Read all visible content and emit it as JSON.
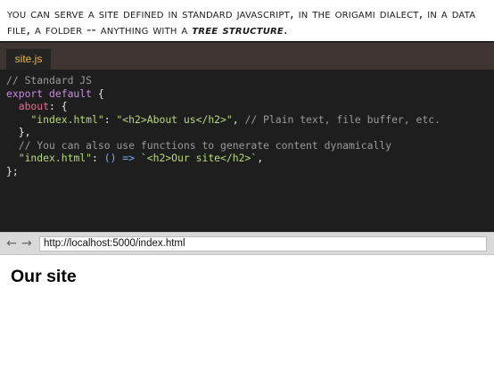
{
  "caption": {
    "part1": "You can serve a site defined in standard JavaScript, in the Origami dialect, in a data file, a folder -- anything with a ",
    "emphasis": "tree structure",
    "end": "."
  },
  "editor": {
    "tab_label": "site.js",
    "code": {
      "l1": "// Standard JS",
      "l2_kw": "export default",
      "l2_rest": " {",
      "l3_prop": "about",
      "l3_rest": ": {",
      "l4_key": "\"index.html\"",
      "l4_colon": ": ",
      "l4_val": "\"<h2>About us</h2>\"",
      "l4_comma": ", ",
      "l4_comment": "// Plain text, file buffer, etc.",
      "l5": "},",
      "l6": "// You can also use functions to generate content dynamically",
      "l7_key": "\"index.html\"",
      "l7_colon": ": ",
      "l7_arrow": "() =>",
      "l7_space": " ",
      "l7_val": "`<h2>Our site</h2>`",
      "l7_comma": ",",
      "l8": "};"
    }
  },
  "browser": {
    "back_icon": "←",
    "forward_icon": "→",
    "url": "http://localhost:5000/index.html"
  },
  "page": {
    "heading": "Our site"
  },
  "colors": {
    "editor_bg": "#1e1e1e",
    "tab_text": "#f0b848",
    "comment": "#9a9a9a",
    "keyword": "#c68edb",
    "property": "#ea6b8f",
    "string": "#b9d97a",
    "operator": "#7fb0e8"
  }
}
